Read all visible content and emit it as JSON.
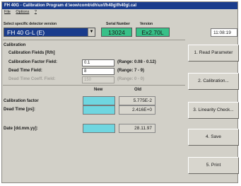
{
  "window": {
    "title": "FH 40G - Calibration Program   d:\\eow\\comb\\dh\\ux\\fh40g\\fh40gl.cal"
  },
  "menu": {
    "items": [
      "File",
      "Options",
      "?"
    ]
  },
  "header": {
    "detector_label": "Select specific detector version",
    "detector_value": "FH 40 G-L (E)",
    "serial_label": "Serial Number",
    "serial_value": "13024",
    "version_label": "Version",
    "version_value": "Ex2.70L",
    "time": "11:08:19"
  },
  "calibration": {
    "section_title": "Calibration",
    "fields_title": "Calibration Fields [R/h]",
    "factor_label": "Calibration Factor Field:",
    "factor_value": "0.1",
    "factor_range": "(Range: 0.08 - 0.12)",
    "dead_label": "Dead Time Field:",
    "dead_value": "8",
    "dead_range": "(Range: 7 - 9)",
    "coeff_label": "Dead Time Coeff. Field:",
    "coeff_value": "150",
    "coeff_range": "(Range: 0 - 0)"
  },
  "results": {
    "new_header": "New",
    "old_header": "Old",
    "cal_factor_label": "Calibration factor",
    "cal_factor_old": "5.775E-2",
    "dead_time_label": "Dead Time [ps]:",
    "dead_time_old": "2.416E+0",
    "date_label": "Date [dd.mm.yy]:",
    "date_old": "28.11.97"
  },
  "buttons": {
    "b1": "1. Read Parameter",
    "b2": "2. Calibration...",
    "b3": "3. Linearity Check...",
    "b4": "4. Save",
    "b5": "5. Print"
  },
  "colors": {
    "title_bar": "#1a3c8c",
    "selected_combo": "#1a3c8c",
    "info_boxes": "#38c088",
    "new_value_boxes": "#6fd6e0",
    "window_face": "#d2d0c8"
  }
}
